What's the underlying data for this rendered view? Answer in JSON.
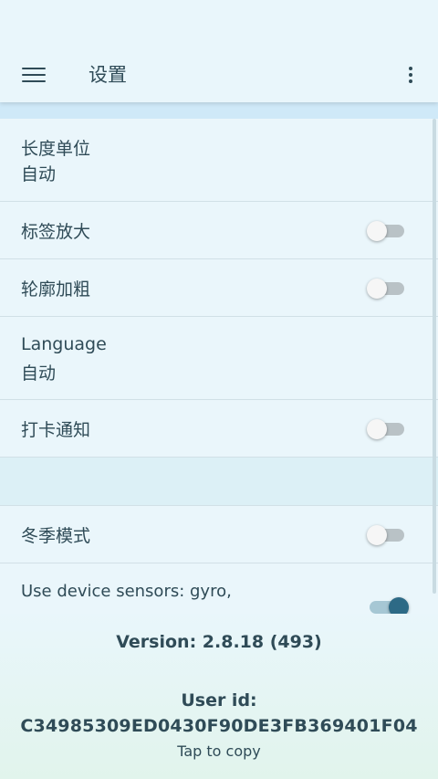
{
  "appbar": {
    "title": "设置"
  },
  "settings": {
    "length_unit": {
      "label": "长度单位",
      "value": "自动"
    },
    "label_zoom": {
      "label": "标签放大",
      "enabled": false
    },
    "outline_bold": {
      "label": "轮廓加粗",
      "enabled": false
    },
    "language": {
      "label": "Language",
      "value": "自动"
    },
    "checkin_notify": {
      "label": "打卡通知",
      "enabled": false
    },
    "winter_mode": {
      "label": "冬季模式",
      "enabled": false
    },
    "device_sensors": {
      "label": "Use device sensors: gyro,",
      "enabled": true
    }
  },
  "footer": {
    "version": "Version: 2.8.18 (493)",
    "user_id_label": "User id:",
    "user_id": "C34985309ED0430F90DE3FB369401F04",
    "tap_to_copy": "Tap to copy"
  },
  "colors": {
    "accent": "#2d6a86",
    "background": "#e9f6fb",
    "text": "#2f4b57"
  }
}
